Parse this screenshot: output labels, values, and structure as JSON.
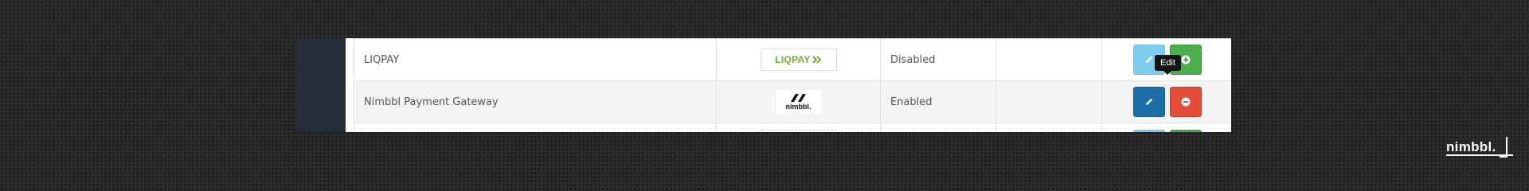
{
  "gateways": [
    {
      "name": "LIQPAY",
      "logo": "LIQPAY",
      "logo_icon": "double-chevron-right-icon",
      "status": "Disabled",
      "extra": "",
      "edit_icon": "pencil-icon",
      "action_icon": "plus-circle-icon",
      "action_color": "#4cae4c"
    },
    {
      "name": "Nimbbl Payment Gateway",
      "logo": "nimbbl.",
      "status": "Enabled",
      "extra": "",
      "edit_icon": "pencil-icon",
      "action_icon": "minus-circle-icon",
      "action_color": "#e34b3b"
    }
  ],
  "tooltip": {
    "text": "Edit"
  },
  "watermark": {
    "text": "nimbbl."
  },
  "colors": {
    "edit_active": "#1e6fa8",
    "edit_idle": "#5bc0eb",
    "add": "#4cae4c",
    "remove": "#e34b3b",
    "liqpay_green": "#6ab130",
    "sidebar": "#262d38"
  }
}
